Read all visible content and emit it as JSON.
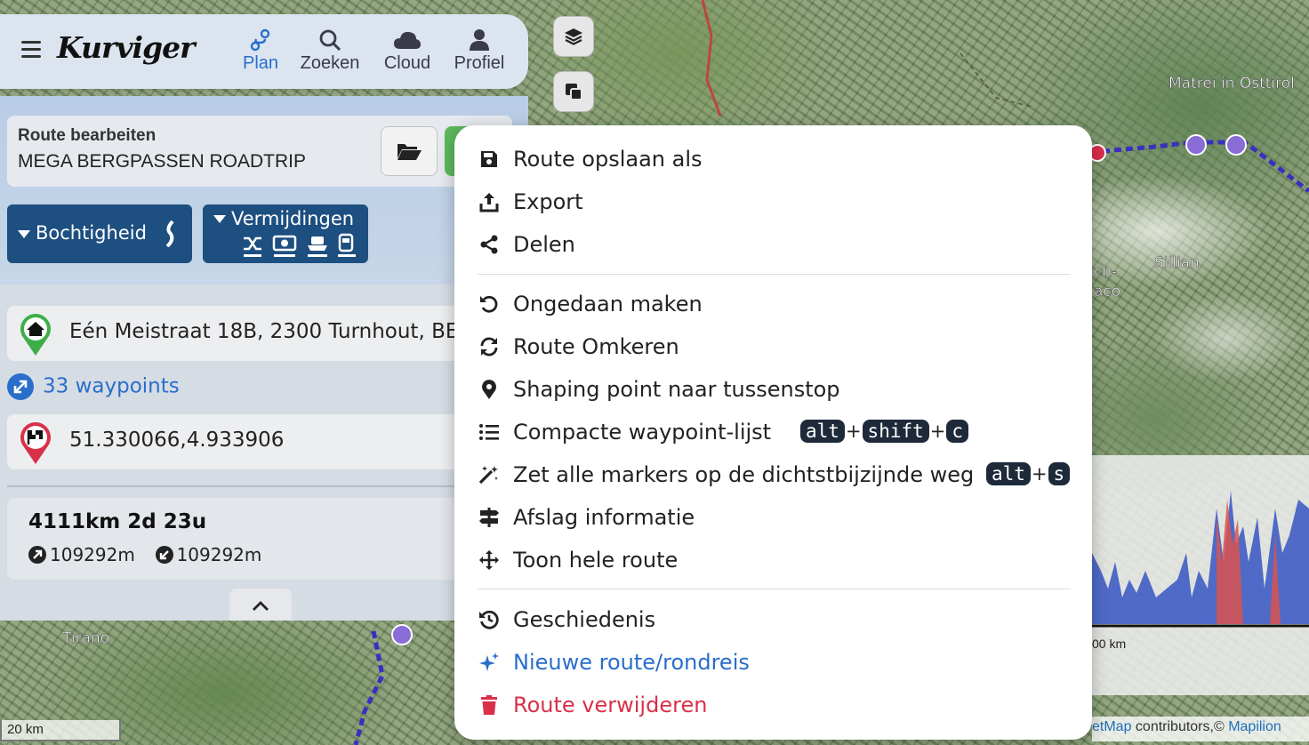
{
  "map": {
    "labels": [
      "Matrei in Osttirol",
      "Sillian",
      "Tirano",
      "ch-",
      "aco"
    ],
    "scale": "20 km",
    "attribution_prefix": "etMap",
    "attribution_mid": " contributors,© ",
    "attribution_link": "Mapilion",
    "elevation_axis": "00 km",
    "controls": [
      "layers-icon",
      "overlay-icon"
    ]
  },
  "app": {
    "logo": "Kurviger",
    "nav": [
      {
        "label": "Plan",
        "icon": "route-plan-icon",
        "active": true
      },
      {
        "label": "Zoeken",
        "icon": "search-icon",
        "active": false
      },
      {
        "label": "Cloud",
        "icon": "cloud-icon",
        "active": false
      },
      {
        "label": "Profiel",
        "icon": "user-icon",
        "active": false
      }
    ]
  },
  "panel": {
    "route_label": "Route bearbeiten",
    "route_name": "MEGA BERGPASSEN ROADTRIP",
    "filters": {
      "curviness": "Bochtigheid",
      "avoid": "Vermijdingen"
    },
    "start": "Eén Meistraat 18B, 2300 Turnhout, BE",
    "waypoints": "33 waypoints",
    "end": "51.330066,4.933906",
    "stats": {
      "main": "4111km  2d 23u",
      "ascent": "109292m",
      "descent": "109292m"
    }
  },
  "menu": {
    "items": [
      {
        "label": "Route opslaan als",
        "icon": "save-icon"
      },
      {
        "label": "Export",
        "icon": "export-icon"
      },
      {
        "label": "Delen",
        "icon": "share-icon"
      },
      {
        "label": "Ongedaan maken",
        "icon": "undo-icon"
      },
      {
        "label": "Route Omkeren",
        "icon": "reverse-icon"
      },
      {
        "label": "Shaping point naar tussenstop",
        "icon": "location-pin-icon"
      },
      {
        "label": "Compacte waypoint-lijst",
        "icon": "list-icon",
        "shortcut": [
          "alt",
          "shift",
          "c"
        ]
      },
      {
        "label": "Zet alle markers op de dichtstbijzijnde weg",
        "icon": "magic-wand-icon",
        "shortcut": [
          "alt",
          "s"
        ]
      },
      {
        "label": "Afslag informatie",
        "icon": "signpost-icon"
      },
      {
        "label": "Toon hele route",
        "icon": "move-arrows-icon"
      },
      {
        "label": "Geschiedenis",
        "icon": "history-icon"
      },
      {
        "label": "Nieuwe route/rondreis",
        "icon": "sparkle-icon"
      },
      {
        "label": "Route verwijderen",
        "icon": "trash-icon"
      }
    ]
  },
  "colors": {
    "accent": "#2a6ecb",
    "danger": "#d9304a",
    "filter_bg": "#1d4f80",
    "kbd_bg": "#1e2a3a"
  }
}
